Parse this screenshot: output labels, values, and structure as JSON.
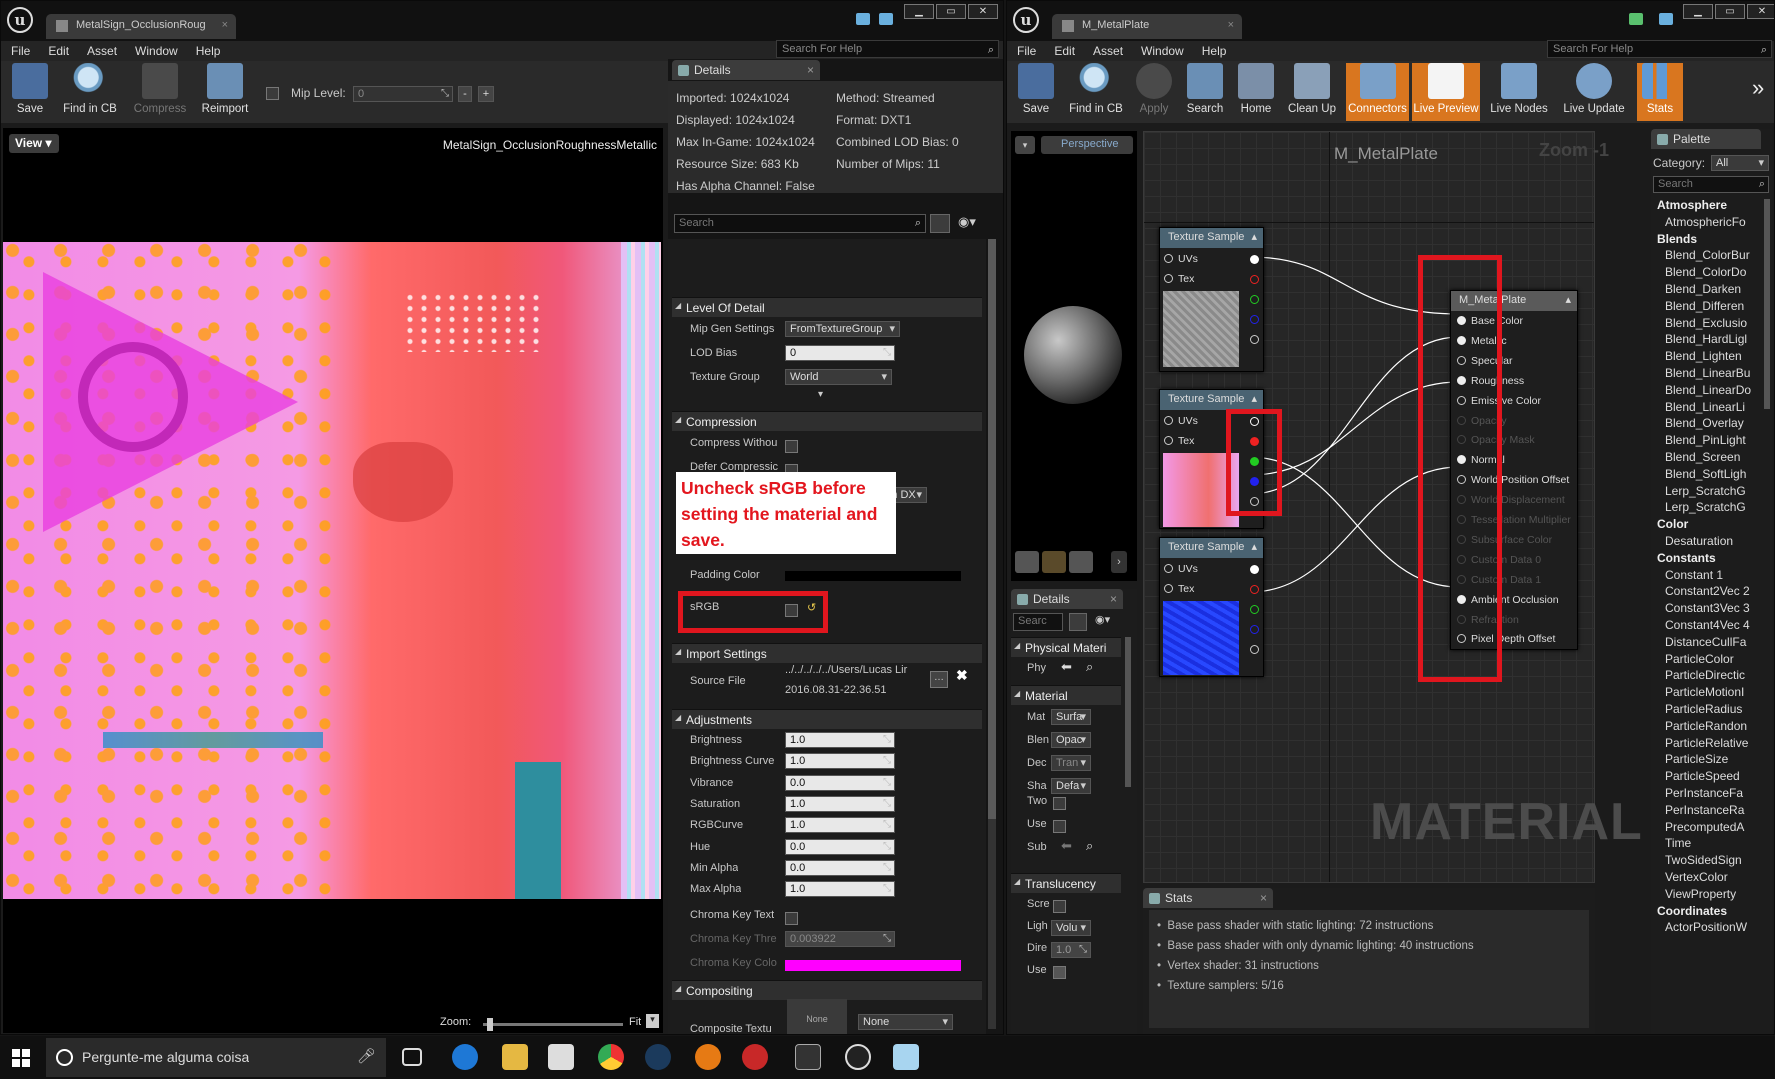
{
  "left_window": {
    "tab_title": "MetalSign_OcclusionRoug",
    "menu": [
      "File",
      "Edit",
      "Asset",
      "Window",
      "Help"
    ],
    "search_help": "Search For Help",
    "toolbar": {
      "save": "Save",
      "find_in_cb": "Find in CB",
      "compress": "Compress",
      "reimport": "Reimport",
      "mip_level_label": "Mip Level:",
      "mip_level_value": "0"
    },
    "viewport": {
      "view_btn": "View",
      "texture_name": "MetalSign_OcclusionRoughnessMetallic",
      "zoom_label": "Zoom:",
      "zoom_value": "Fit"
    }
  },
  "details": {
    "tab": "Details",
    "info_left": [
      "Imported: 1024x1024",
      "Displayed: 1024x1024",
      "Max In-Game: 1024x1024",
      "Resource Size: 683 Kb",
      "Has Alpha Channel: False"
    ],
    "info_right": [
      "Method: Streamed",
      "Format: DXT1",
      "Combined LOD Bias: 0",
      "Number of Mips: 11"
    ],
    "search_placeholder": "Search",
    "lod": {
      "title": "Level Of Detail",
      "mip_gen_label": "Mip Gen Settings",
      "mip_gen_value": "FromTextureGroup",
      "lod_bias_label": "LOD Bias",
      "lod_bias_value": "0",
      "texture_group_label": "Texture Group",
      "texture_group_value": "World"
    },
    "compression": {
      "title": "Compression",
      "compress_without_label": "Compress Withou",
      "defer_label": "Defer Compressic",
      "dx_value": "3 on DX",
      "padding_label": "Padding Color",
      "srgb_label": "sRGB"
    },
    "annotation": "Uncheck sRGB before setting the material and save.",
    "import": {
      "title": "Import Settings",
      "source_label": "Source File",
      "source_path": "../../../../../Users/Lucas Lir",
      "source_date": "2016.08.31-22.36.51"
    },
    "adjustments": {
      "title": "Adjustments",
      "rows": [
        {
          "label": "Brightness",
          "value": "1.0"
        },
        {
          "label": "Brightness Curve",
          "value": "1.0"
        },
        {
          "label": "Vibrance",
          "value": "0.0"
        },
        {
          "label": "Saturation",
          "value": "1.0"
        },
        {
          "label": "RGBCurve",
          "value": "1.0"
        },
        {
          "label": "Hue",
          "value": "0.0"
        },
        {
          "label": "Min Alpha",
          "value": "0.0"
        },
        {
          "label": "Max Alpha",
          "value": "1.0"
        }
      ],
      "chroma_text_label": "Chroma Key Text",
      "chroma_thresh_label": "Chroma Key Thre",
      "chroma_thresh_value": "0.003922",
      "chroma_color_label": "Chroma Key Colo",
      "chroma_color": "#ff00ff"
    },
    "compositing": {
      "title": "Compositing",
      "texture_label": "Composite Textu",
      "none_thumb": "None",
      "none_drop": "None"
    }
  },
  "right_window": {
    "tab_title": "M_MetalPlate",
    "menu": [
      "File",
      "Edit",
      "Asset",
      "Window",
      "Help"
    ],
    "search_help": "Search For Help",
    "toolbar": [
      "Save",
      "Find in CB",
      "Apply",
      "Search",
      "Home",
      "Clean Up",
      "Connectors",
      "Live Preview",
      "Live Nodes",
      "Live Update",
      "Stats"
    ],
    "viewport_mode": "Perspective",
    "details": {
      "tab": "Details",
      "search": "Searc",
      "physical": "Physical Materi",
      "phy_label": "Phy",
      "material": "Material",
      "mat_rows": [
        {
          "label": "Mat",
          "value": "Surfa"
        },
        {
          "label": "Blen",
          "value": "Opac"
        },
        {
          "label": "Dec",
          "value": "Tran"
        },
        {
          "label": "Sha",
          "value": "Defa"
        }
      ],
      "chk_rows": [
        "Two",
        "Use"
      ],
      "sub_label": "Sub",
      "translucency": "Translucency",
      "trans_rows": [
        {
          "label": "Scre"
        },
        {
          "label": "Ligh",
          "value": "Volu"
        },
        {
          "label": "Dire",
          "value": "1.0"
        },
        {
          "label": "Use"
        }
      ]
    },
    "graph": {
      "title": "M_MetalPlate",
      "zoom": "Zoom -1",
      "watermark": "MATERIAL",
      "tex_nodes": [
        {
          "title": "Texture Sample",
          "uvs": "UVs",
          "tex": "Tex"
        },
        {
          "title": "Texture Sample",
          "uvs": "UVs",
          "tex": "Tex"
        },
        {
          "title": "Texture Sample",
          "uvs": "UVs",
          "tex": "Tex"
        }
      ],
      "mat_node": {
        "title": "M_MetalPlate",
        "pins": [
          "Base Color",
          "Metallic",
          "Specular",
          "Roughness",
          "Emissive Color",
          "Opacity",
          "Opacity Mask",
          "Normal",
          "World Position Offset",
          "World Displacement",
          "Tessellation Multiplier",
          "Subsurface Color",
          "Custom Data 0",
          "Custom Data 1",
          "Ambient Occlusion",
          "Refraction",
          "Pixel Depth Offset"
        ]
      }
    },
    "stats": {
      "tab": "Stats",
      "lines": [
        "Base pass shader with static lighting: 72 instructions",
        "Base pass shader with only dynamic lighting: 40 instructions",
        "Vertex shader: 31 instructions",
        "Texture samplers: 5/16"
      ]
    },
    "palette": {
      "tab": "Palette",
      "category_label": "Category:",
      "category_value": "All",
      "search": "Search",
      "items": [
        {
          "cat": "Atmosphere"
        },
        {
          "t": "AtmosphericFo"
        },
        {
          "cat": "Blends"
        },
        {
          "t": "Blend_ColorBur"
        },
        {
          "t": "Blend_ColorDo"
        },
        {
          "t": "Blend_Darken"
        },
        {
          "t": "Blend_Differen"
        },
        {
          "t": "Blend_Exclusio"
        },
        {
          "t": "Blend_HardLigl"
        },
        {
          "t": "Blend_Lighten"
        },
        {
          "t": "Blend_LinearBu"
        },
        {
          "t": "Blend_LinearDo"
        },
        {
          "t": "Blend_LinearLi"
        },
        {
          "t": "Blend_Overlay"
        },
        {
          "t": "Blend_PinLight"
        },
        {
          "t": "Blend_Screen"
        },
        {
          "t": "Blend_SoftLigh"
        },
        {
          "t": "Lerp_ScratchG"
        },
        {
          "t": "Lerp_ScratchG"
        },
        {
          "cat": "Color"
        },
        {
          "t": "Desaturation"
        },
        {
          "cat": "Constants"
        },
        {
          "t": "Constant        1"
        },
        {
          "t": "Constant2Vec 2"
        },
        {
          "t": "Constant3Vec 3"
        },
        {
          "t": "Constant4Vec 4"
        },
        {
          "t": "DistanceCullFa"
        },
        {
          "t": "ParticleColor"
        },
        {
          "t": "ParticleDirectic"
        },
        {
          "t": "ParticleMotionI"
        },
        {
          "t": "ParticleRadius"
        },
        {
          "t": "ParticleRandon"
        },
        {
          "t": "ParticleRelative"
        },
        {
          "t": "ParticleSize"
        },
        {
          "t": "ParticleSpeed"
        },
        {
          "t": "PerInstanceFa"
        },
        {
          "t": "PerInstanceRa"
        },
        {
          "t": "PrecomputedA"
        },
        {
          "t": "Time"
        },
        {
          "t": "TwoSidedSign"
        },
        {
          "t": "VertexColor"
        },
        {
          "t": "ViewProperty"
        },
        {
          "cat": "Coordinates"
        },
        {
          "t": "ActorPositionW"
        }
      ]
    }
  },
  "taskbar": {
    "search": "Pergunte-me alguma coisa"
  }
}
